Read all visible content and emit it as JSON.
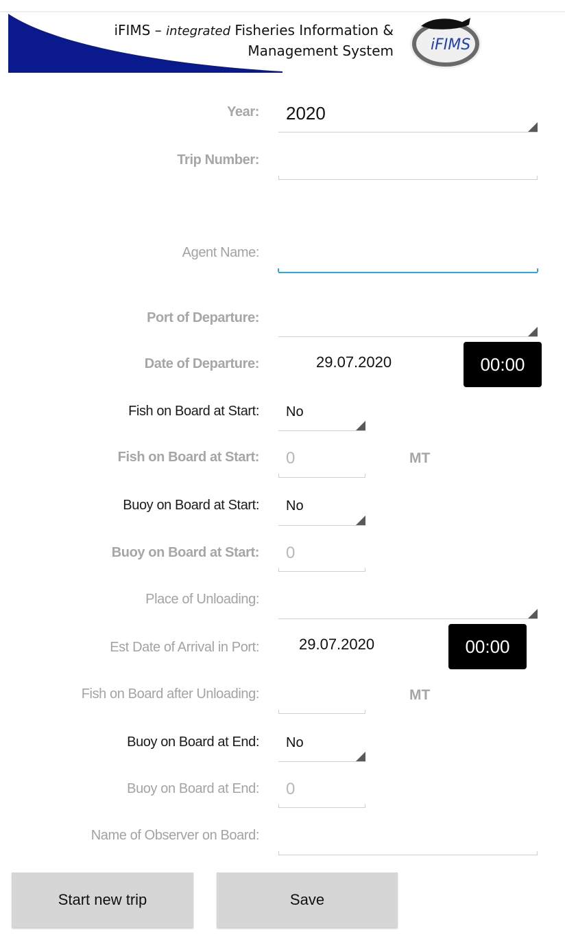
{
  "banner": {
    "prefix": "iFIMS – ",
    "italic": "integrated",
    "line1_rest": " Fisheries Information &",
    "line2": "Management System",
    "logo_text": "iFIMS"
  },
  "form": {
    "year": {
      "label": "Year:",
      "value": "2020"
    },
    "trip_number": {
      "label": "Trip Number:",
      "value": ""
    },
    "agent_name": {
      "label": "Agent Name:",
      "value": ""
    },
    "port_of_departure": {
      "label": "Port of Departure:",
      "value": ""
    },
    "date_of_departure": {
      "label": "Date of Departure:",
      "date": "29.07.2020",
      "time": "00:00"
    },
    "fish_on_board_start_select": {
      "label": "Fish on Board at Start:",
      "value": "No"
    },
    "fish_on_board_start_qty": {
      "label": "Fish on Board at Start:",
      "placeholder": "0",
      "unit": "MT"
    },
    "buoy_on_board_start_select": {
      "label": "Buoy on Board at Start:",
      "value": "No"
    },
    "buoy_on_board_start_qty": {
      "label": "Buoy on Board at Start:",
      "placeholder": "0"
    },
    "place_of_unloading": {
      "label": "Place of Unloading:",
      "value": ""
    },
    "est_date_arrival": {
      "label": "Est Date of Arrival in Port:",
      "date": "29.07.2020",
      "time": "00:00"
    },
    "fish_after_unloading": {
      "label": "Fish on Board after Unloading:",
      "value": "",
      "unit": "MT"
    },
    "buoy_on_board_end_select": {
      "label": "Buoy on Board at End:",
      "value": "No"
    },
    "buoy_on_board_end_qty": {
      "label": "Buoy on Board at End:",
      "placeholder": "0"
    },
    "observer_name": {
      "label": "Name of Observer on Board:",
      "value": ""
    }
  },
  "buttons": {
    "start_new_trip": "Start new trip",
    "save": "Save"
  },
  "colors": {
    "banner_blue": "#0a1a8c",
    "field_focus": "#2aa7e0",
    "time_button": "#000000",
    "button_bg": "#d6d6d6"
  }
}
